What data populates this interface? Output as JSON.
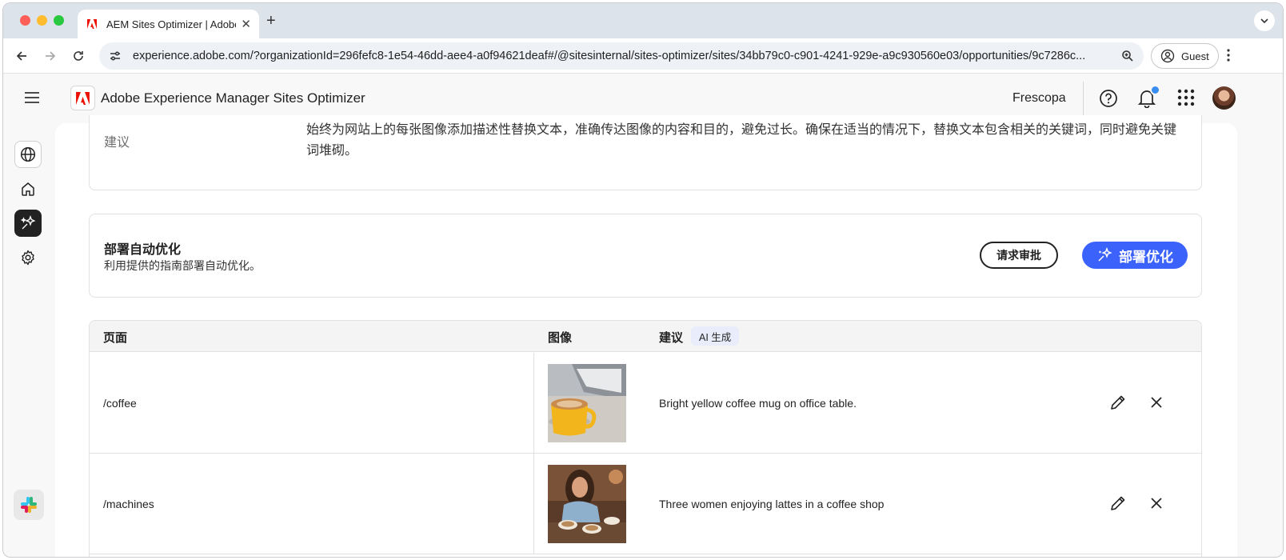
{
  "browser": {
    "tab_title": "AEM Sites Optimizer | Adobe",
    "url": "experience.adobe.com/?organizationId=296fefc8-1e54-46dd-aee4-a0f94621deaf#/@sitesinternal/sites-optimizer/sites/34bb79c0-c901-4241-929e-a9c930560e03/opportunities/9c7286c...",
    "guest_label": "Guest"
  },
  "header": {
    "app_title": "Adobe Experience Manager Sites Optimizer",
    "org_name": "Frescopa"
  },
  "recommendation": {
    "label": "建议",
    "text": "始终为网站上的每张图像添加描述性替换文本，准确传达图像的内容和目的，避免过长。确保在适当的情况下，替换文本包含相关的关键词，同时避免关键词堆砌。"
  },
  "deploy": {
    "title": "部署自动优化",
    "subtitle": "利用提供的指南部署自动优化。",
    "request_button": "请求审批",
    "deploy_button": "部署优化"
  },
  "table": {
    "headers": {
      "page": "页面",
      "image": "图像",
      "suggestion": "建议",
      "ai_badge": "AI 生成"
    },
    "rows": [
      {
        "page": "/coffee",
        "suggestion": "Bright yellow coffee mug on office table."
      },
      {
        "page": "/machines",
        "suggestion": "Three women enjoying lattes in a coffee shop"
      }
    ]
  },
  "colors": {
    "accent": "#3b63fb",
    "adobe_red": "#eb1000",
    "notification": "#378ef0"
  }
}
